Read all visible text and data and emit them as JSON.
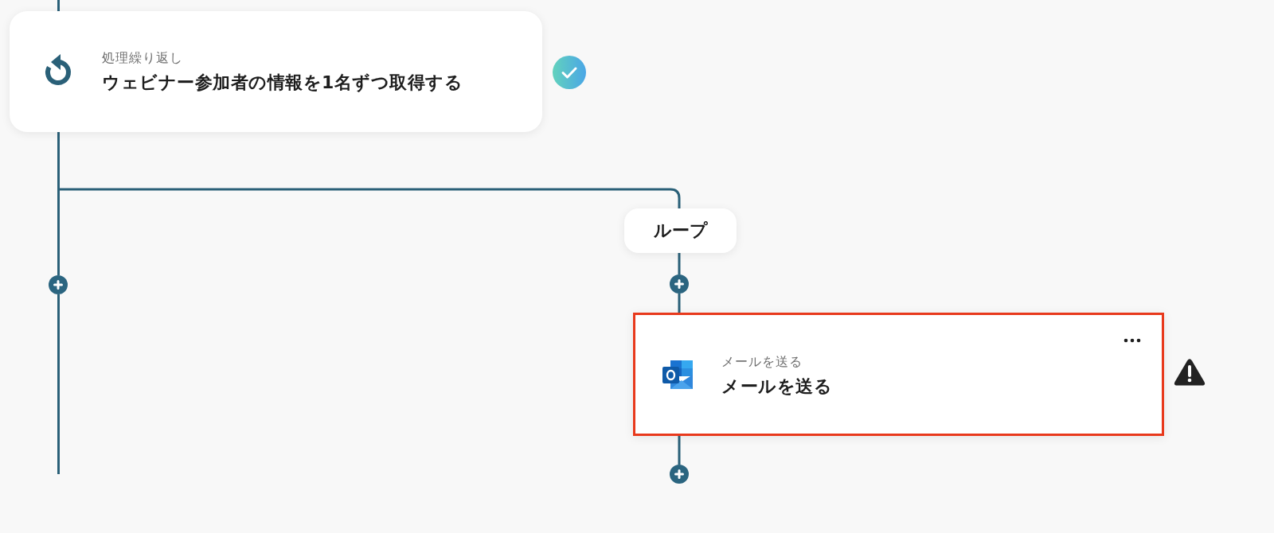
{
  "flow": {
    "loop_step": {
      "caption": "処理繰り返し",
      "title": "ウェビナー参加者の情報を1名ずつ取得する",
      "completed": true
    },
    "branch_label": "ループ",
    "action_step": {
      "caption": "メールを送る",
      "title": "メールを送る",
      "selected": true,
      "warning": true
    }
  }
}
